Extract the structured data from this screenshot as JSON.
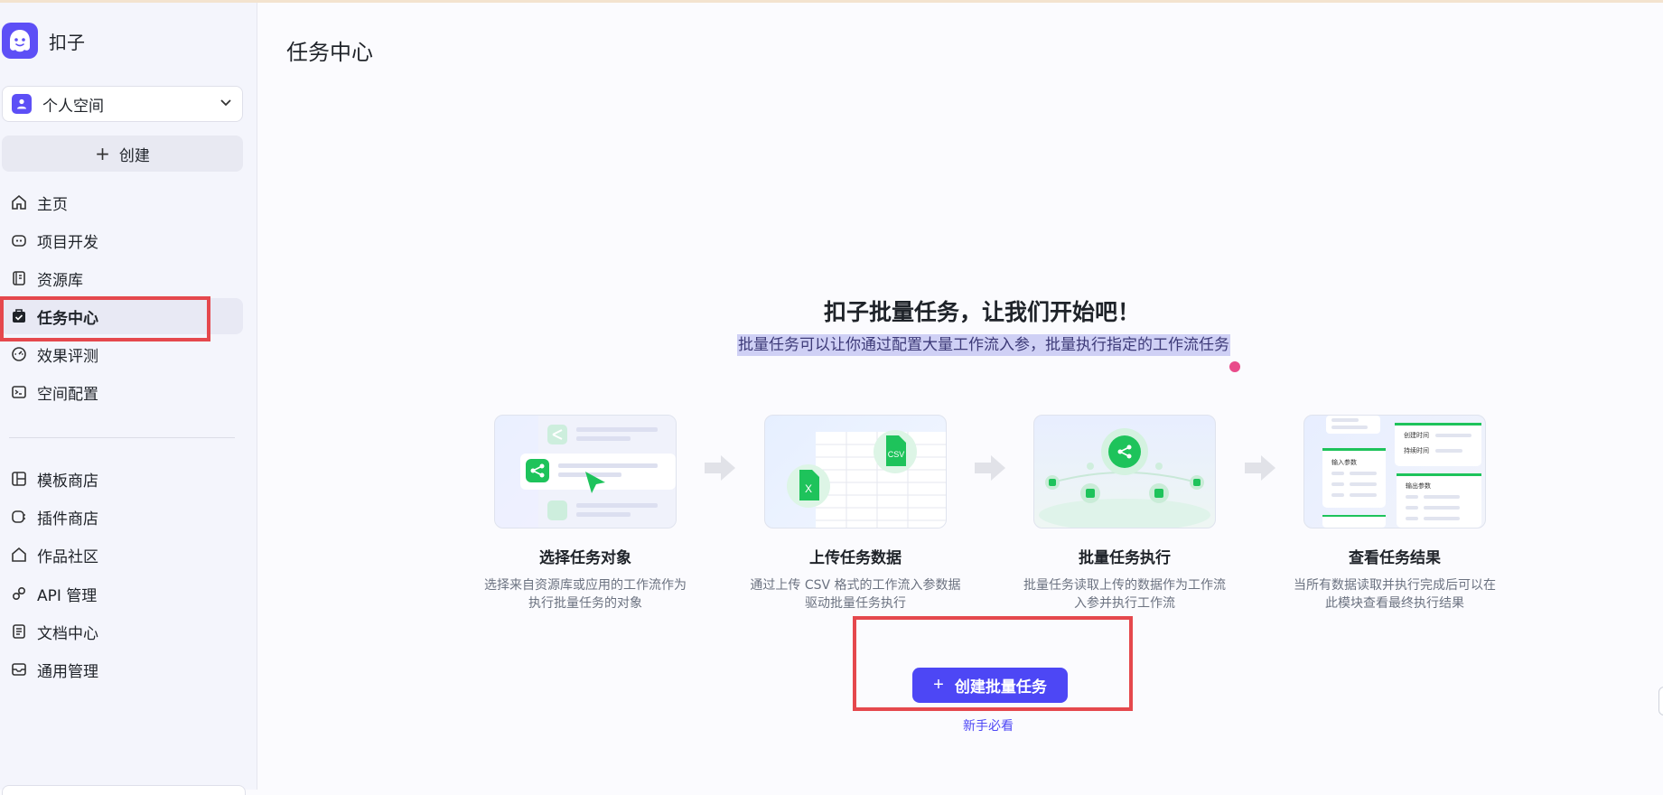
{
  "app": {
    "name": "扣子"
  },
  "sidebar": {
    "space": {
      "label": "个人空间"
    },
    "create_label": "创建",
    "primary_items": [
      {
        "label": "主页",
        "icon": "home-icon"
      },
      {
        "label": "项目开发",
        "icon": "project-icon"
      },
      {
        "label": "资源库",
        "icon": "library-icon"
      },
      {
        "label": "任务中心",
        "icon": "task-icon",
        "active": true
      },
      {
        "label": "效果评测",
        "icon": "gauge-icon"
      },
      {
        "label": "空间配置",
        "icon": "terminal-icon"
      }
    ],
    "secondary_items": [
      {
        "label": "模板商店",
        "icon": "template-icon"
      },
      {
        "label": "插件商店",
        "icon": "plugin-icon"
      },
      {
        "label": "作品社区",
        "icon": "community-icon"
      },
      {
        "label": "API 管理",
        "icon": "api-icon"
      },
      {
        "label": "文档中心",
        "icon": "document-icon"
      },
      {
        "label": "通用管理",
        "icon": "inbox-icon"
      }
    ]
  },
  "main": {
    "page_title": "任务中心",
    "hero": {
      "title": "扣子批量任务，让我们开始吧！",
      "subtitle": "批量任务可以让你通过配置大量工作流入参，批量执行指定的工作流任务"
    },
    "steps": [
      {
        "title": "选择任务对象",
        "desc_line1": "选择来自资源库或应用的工作流作为",
        "desc_line2": "执行批量任务的对象"
      },
      {
        "title": "上传任务数据",
        "desc_line1": "通过上传 CSV 格式的工作流入参数据",
        "desc_line2": "驱动批量任务执行",
        "card_csv": "CSV",
        "card_x": "X"
      },
      {
        "title": "批量任务执行",
        "desc_line1": "批量任务读取上传的数据作为工作流",
        "desc_line2": "入参并执行工作流"
      },
      {
        "title": "查看任务结果",
        "desc_line1": "当所有数据读取并执行完成后可以在",
        "desc_line2": "此模块查看最终执行结果",
        "card_labels": [
          "创建时间",
          "持续时间",
          "输入参数",
          "输出参数"
        ]
      }
    ],
    "create_batch_label": "创建批量任务",
    "guide_link": "新手必看"
  },
  "colors": {
    "accent": "#4d47f5",
    "highlight": "#e5484d",
    "brand": "#5d4ff6",
    "step_green": "#1ec35b"
  }
}
